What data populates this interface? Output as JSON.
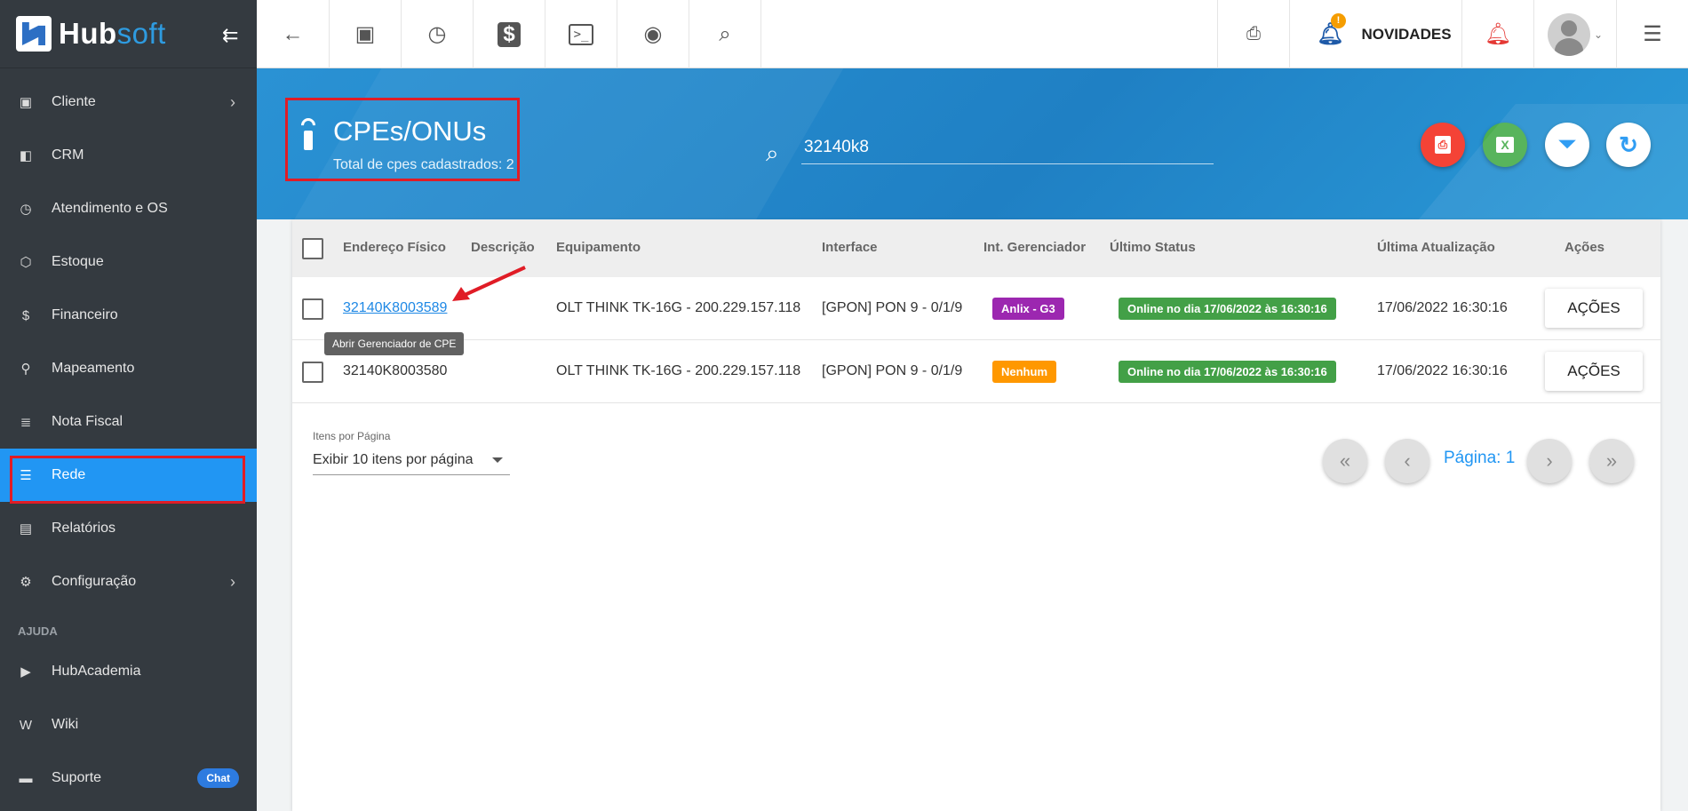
{
  "brand": {
    "name_part1": "Hub",
    "name_part2": "soft"
  },
  "sidebar": {
    "items": [
      {
        "label": "Cliente",
        "icon": "id-card-icon",
        "has_chevron": true
      },
      {
        "label": "CRM",
        "icon": "board-icon"
      },
      {
        "label": "Atendimento e OS",
        "icon": "calendar-clock-icon"
      },
      {
        "label": "Estoque",
        "icon": "box-icon"
      },
      {
        "label": "Financeiro",
        "icon": "money-icon"
      },
      {
        "label": "Mapeamento",
        "icon": "map-pin-icon"
      },
      {
        "label": "Nota Fiscal",
        "icon": "document-icon"
      },
      {
        "label": "Rede",
        "icon": "server-icon",
        "active": true
      },
      {
        "label": "Relatórios",
        "icon": "report-icon"
      },
      {
        "label": "Configuração",
        "icon": "gear-icon",
        "has_chevron": true
      }
    ],
    "help_section": "AJUDA",
    "help_items": [
      {
        "label": "HubAcademia",
        "icon": "youtube-icon"
      },
      {
        "label": "Wiki",
        "icon": "wiki-icon"
      },
      {
        "label": "Suporte",
        "icon": "chat-icon",
        "badge": "Chat"
      }
    ]
  },
  "topbar": {
    "news_label": "NOVIDADES",
    "news_badge": "!"
  },
  "header": {
    "title": "CPEs/ONUs",
    "subtitle": "Total de cpes cadastrados: 2",
    "search_value": "32140k8"
  },
  "table": {
    "headers": {
      "mac": "Endereço Físico",
      "descricao": "Descrição",
      "equipamento": "Equipamento",
      "interface": "Interface",
      "gerenciador": "Int. Gerenciador",
      "status": "Último Status",
      "atualizacao": "Última Atualização",
      "acoes": "Ações"
    },
    "rows": [
      {
        "mac": "32140K8003589",
        "equipamento": "OLT THINK TK-16G - 200.229.157.118",
        "interface": "[GPON] PON 9 - 0/1/9",
        "gerenciador": "Anlix - G3",
        "status": "Online no dia 17/06/2022 às 16:30:16",
        "atualizacao": "17/06/2022 16:30:16",
        "acoes": "AÇÕES"
      },
      {
        "mac": "32140K8003580",
        "equipamento": "OLT THINK TK-16G - 200.229.157.118",
        "interface": "[GPON] PON 9 - 0/1/9",
        "gerenciador": "Nenhum",
        "status": "Online no dia 17/06/2022 às 16:30:16",
        "atualizacao": "17/06/2022 16:30:16",
        "acoes": "AÇÕES"
      }
    ],
    "tooltip": "Abrir Gerenciador de CPE"
  },
  "pagination": {
    "label": "Itens por Página",
    "selected": "Exibir 10 itens por página",
    "page": "Página: 1"
  },
  "colors": {
    "accent": "#2196f3",
    "sidebar_bg": "#343a40",
    "highlight": "#e01c26"
  }
}
